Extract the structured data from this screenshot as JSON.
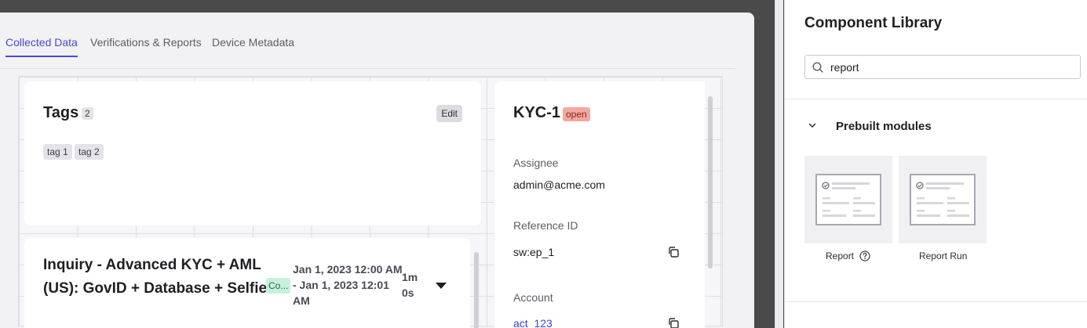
{
  "canvas": {
    "tabs": [
      {
        "label": "Collected Data",
        "active": true
      },
      {
        "label": "Verifications & Reports",
        "active": false
      },
      {
        "label": "Device Metadata",
        "active": false
      }
    ]
  },
  "tags_card": {
    "title": "Tags",
    "count": "2",
    "edit_label": "Edit",
    "tags": [
      "tag 1",
      "tag 2"
    ]
  },
  "inquiry_card": {
    "title": "Inquiry - Advanced KYC + AML (US): GovID + Database + Selfie",
    "status": "Co...",
    "dates": "Jan 1, 2023 12:00 AM - Jan 1, 2023 12:01 AM",
    "duration": "1m 0s"
  },
  "kyc_card": {
    "title": "KYC-1",
    "status": "open",
    "fields": {
      "assignee_label": "Assignee",
      "assignee_value": "admin@acme.com",
      "reference_label": "Reference ID",
      "reference_value": "sw:ep_1",
      "account_label": "Account",
      "account_value": "act_123"
    }
  },
  "panel": {
    "title": "Component Library",
    "search_value": "report",
    "section_title": "Prebuilt modules",
    "modules": [
      {
        "label": "Report"
      },
      {
        "label": "Report Run"
      }
    ]
  },
  "colors": {
    "accent": "#4b46d8",
    "open_badge": "#f4a79d",
    "status_badge": "#c9f0dd",
    "link": "#3d44d6"
  }
}
